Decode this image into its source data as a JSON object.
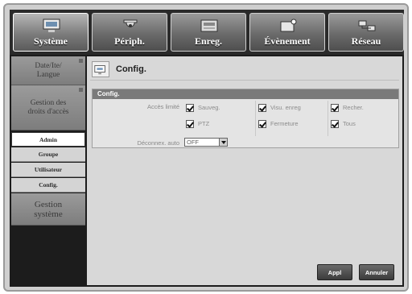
{
  "menu": {
    "tabs": [
      {
        "label": "Système",
        "icon": "system-icon"
      },
      {
        "label": "Périph.",
        "icon": "device-icon"
      },
      {
        "label": "Enreg.",
        "icon": "record-icon"
      },
      {
        "label": "Évènement",
        "icon": "event-icon"
      },
      {
        "label": "Réseau",
        "icon": "network-icon"
      }
    ]
  },
  "sidebar": {
    "items": [
      {
        "label": "Date/Ite/ Langue"
      },
      {
        "label": "Gestion des droits d'accès"
      },
      {
        "label": "Gestion système"
      }
    ],
    "subitems": [
      "Admin",
      "Groupe",
      "Utilisateur",
      "Config."
    ]
  },
  "main": {
    "header_title": "Config.",
    "group_title": "Config.",
    "access_label": "Accès limité",
    "checkboxes": [
      "Sauveg.",
      "Visu. enreg",
      "Recher.",
      "PTZ",
      "Fermeture",
      "Tous"
    ],
    "logout_label": "Déconnex. auto",
    "logout_value": "OFF",
    "buttons": {
      "apply": "Appl",
      "cancel": "Annuler"
    }
  }
}
